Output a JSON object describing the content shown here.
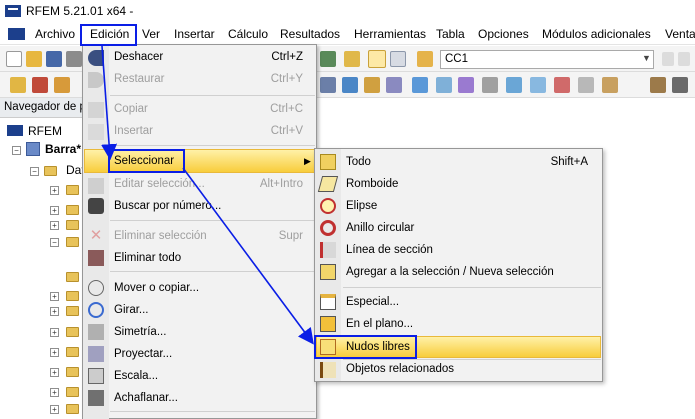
{
  "window": {
    "title": "RFEM 5.21.01 x64 -"
  },
  "menubar": {
    "items": [
      "Archivo",
      "Edición",
      "Ver",
      "Insertar",
      "Cálculo",
      "Resultados",
      "Herramientas",
      "Tabla",
      "Opciones",
      "Módulos adicionales",
      "Ventar"
    ]
  },
  "toolbar": {
    "load_case": "CC1"
  },
  "navigator": {
    "header": "Navegador de p",
    "root": "RFEM",
    "project": "Barra*",
    "data_folder": "Dat"
  },
  "edit_menu": {
    "items": [
      {
        "label": "Deshacer",
        "shortcut": "Ctrl+Z",
        "disabled": false
      },
      {
        "label": "Restaurar",
        "shortcut": "Ctrl+Y",
        "disabled": true
      },
      {
        "label": "Copiar",
        "shortcut": "Ctrl+C",
        "disabled": true
      },
      {
        "label": "Insertar",
        "shortcut": "Ctrl+V",
        "disabled": true
      },
      {
        "label": "Seleccionar",
        "shortcut": "",
        "disabled": false,
        "highlighted": true
      },
      {
        "label": "Editar selección...",
        "shortcut": "Alt+Intro",
        "disabled": true
      },
      {
        "label": "Buscar por número...",
        "shortcut": "",
        "disabled": false
      },
      {
        "label": "Eliminar selección",
        "shortcut": "Supr",
        "disabled": true
      },
      {
        "label": "Eliminar todo",
        "shortcut": "",
        "disabled": false
      },
      {
        "label": "Mover o copiar...",
        "shortcut": "",
        "disabled": false
      },
      {
        "label": "Girar...",
        "shortcut": "",
        "disabled": false
      },
      {
        "label": "Simetría...",
        "shortcut": "",
        "disabled": false
      },
      {
        "label": "Proyectar...",
        "shortcut": "",
        "disabled": false
      },
      {
        "label": "Escala...",
        "shortcut": "",
        "disabled": false
      },
      {
        "label": "Achaflanar...",
        "shortcut": "",
        "disabled": false
      }
    ]
  },
  "select_submenu": {
    "items": [
      {
        "label": "Todo",
        "shortcut": "Shift+A"
      },
      {
        "label": "Romboide",
        "shortcut": ""
      },
      {
        "label": "Elipse",
        "shortcut": ""
      },
      {
        "label": "Anillo circular",
        "shortcut": ""
      },
      {
        "label": "Línea de sección",
        "shortcut": ""
      },
      {
        "label": "Agregar a la selección / Nueva selección",
        "shortcut": ""
      },
      {
        "label": "Especial...",
        "shortcut": ""
      },
      {
        "label": "En el plano...",
        "shortcut": ""
      },
      {
        "label": "Nudos libres",
        "shortcut": "",
        "highlighted": true
      },
      {
        "label": "Objetos relacionados",
        "shortcut": ""
      }
    ]
  },
  "colors": {
    "highlight_top": "#fff1a8",
    "highlight_bottom": "#f8cd3c",
    "annotation": "#0a1ee6",
    "app_blue": "#1c3f8c"
  }
}
